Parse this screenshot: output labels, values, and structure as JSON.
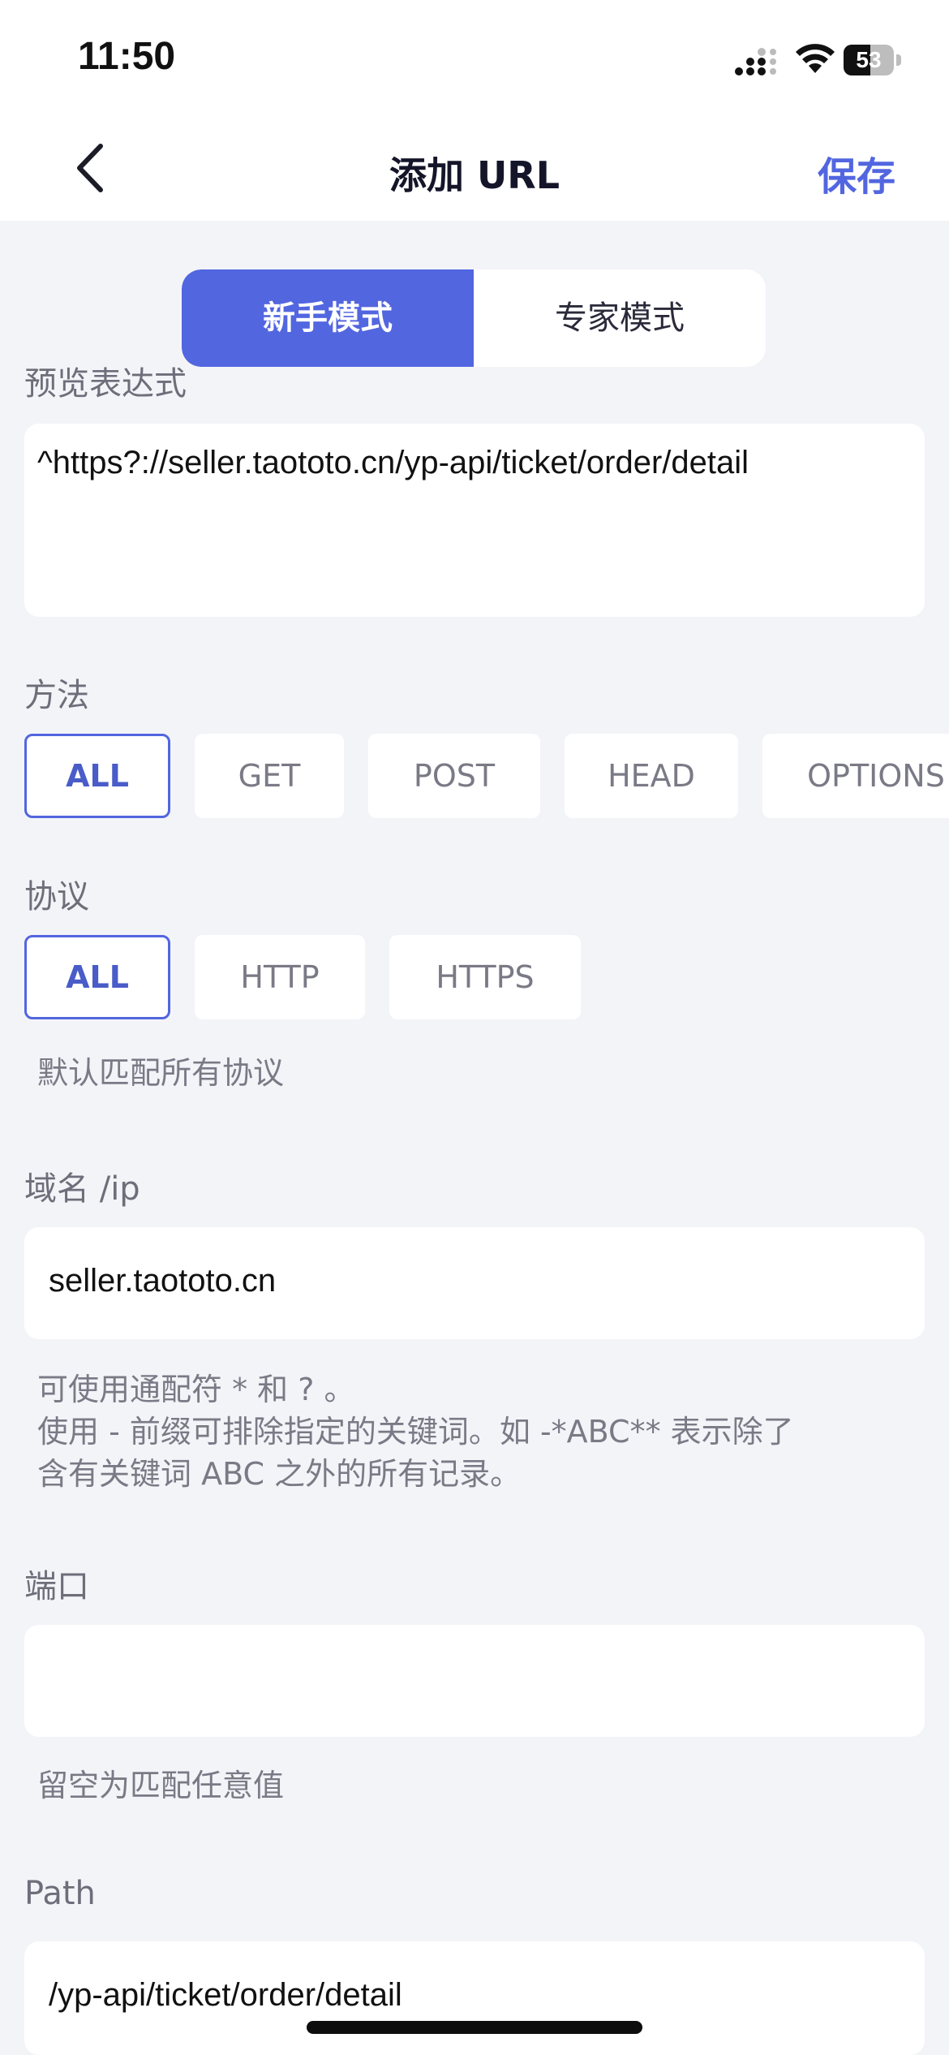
{
  "status_bar": {
    "time": "11:50",
    "battery": "53"
  },
  "nav": {
    "title": "添加 URL",
    "save_label": "保存"
  },
  "mode_toggle": {
    "beginner": "新手模式",
    "expert": "专家模式"
  },
  "preview": {
    "label": "预览表达式",
    "expression": "^https?://seller.taototo.cn/yp-api/ticket/order/detail"
  },
  "method": {
    "label": "方法",
    "options": [
      "ALL",
      "GET",
      "POST",
      "HEAD",
      "OPTIONS"
    ],
    "selected": "ALL"
  },
  "protocol": {
    "label": "协议",
    "options": [
      "ALL",
      "HTTP",
      "HTTPS"
    ],
    "selected": "ALL",
    "hint": "默认匹配所有协议"
  },
  "domain": {
    "label": "域名 /ip",
    "value": "seller.taototo.cn",
    "hint_lines": [
      "可使用通配符 * 和 ? 。",
      "使用 - 前缀可排除指定的关键词。如 -*ABC**  表示除了",
      "含有关键词 ABC 之外的所有记录。"
    ]
  },
  "port": {
    "label": "端口",
    "value": "",
    "hint": "留空为匹配任意值"
  },
  "path": {
    "label": "Path",
    "value": "/yp-api/ticket/order/detail"
  },
  "colors": {
    "accent": "#5266e0",
    "background": "#f3f4f8",
    "card": "#ffffff"
  }
}
